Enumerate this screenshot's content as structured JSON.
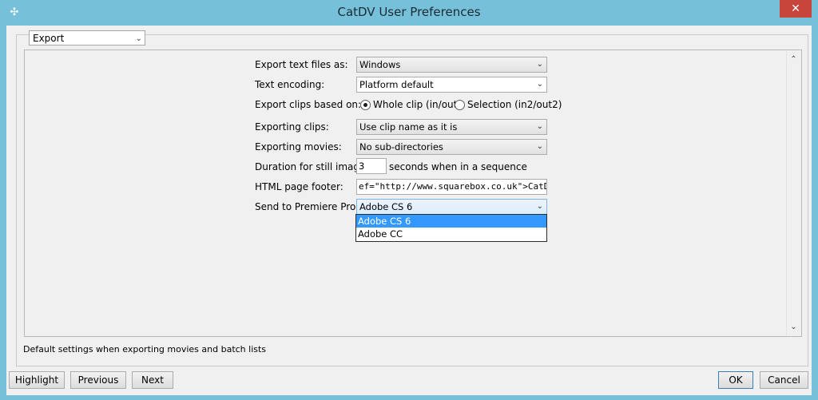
{
  "window": {
    "title": "CatDV User Preferences",
    "app_icon": "catdv-app-icon",
    "close_glyph": "✕"
  },
  "category": {
    "selected": "Export"
  },
  "form": {
    "export_text_files": {
      "label": "Export text files as:",
      "value": "Windows"
    },
    "text_encoding": {
      "label": "Text encoding:",
      "value": "Platform default"
    },
    "export_clips_based_on": {
      "label": "Export clips based on:",
      "options": [
        {
          "label": "Whole clip (in/out)",
          "checked": true
        },
        {
          "label": "Selection (in2/out2)",
          "checked": false
        }
      ]
    },
    "exporting_clips": {
      "label": "Exporting clips:",
      "value": "Use clip name as it is"
    },
    "exporting_movies": {
      "label": "Exporting movies:",
      "value": "No sub-directories"
    },
    "duration_still_images": {
      "label": "Duration for still images:",
      "value": "3",
      "suffix": "seconds when in a sequence"
    },
    "html_page_footer": {
      "label": "HTML page footer:",
      "value": "ef=\"http://www.squarebox.co.uk\">CatDV</a>"
    },
    "send_to_premiere": {
      "label": "Send to Premiere Pro:",
      "value": "Adobe CS 6",
      "options": [
        "Adobe CS 6",
        "Adobe CC"
      ],
      "highlighted_index": 0
    }
  },
  "description": "Default settings when exporting movies and batch lists",
  "buttons": {
    "highlight": "Highlight",
    "previous": "Previous",
    "next": "Next",
    "ok": "OK",
    "cancel": "Cancel"
  },
  "colors": {
    "titlebar": "#76c1d9",
    "close": "#c7453a",
    "selection": "#3399ff"
  }
}
